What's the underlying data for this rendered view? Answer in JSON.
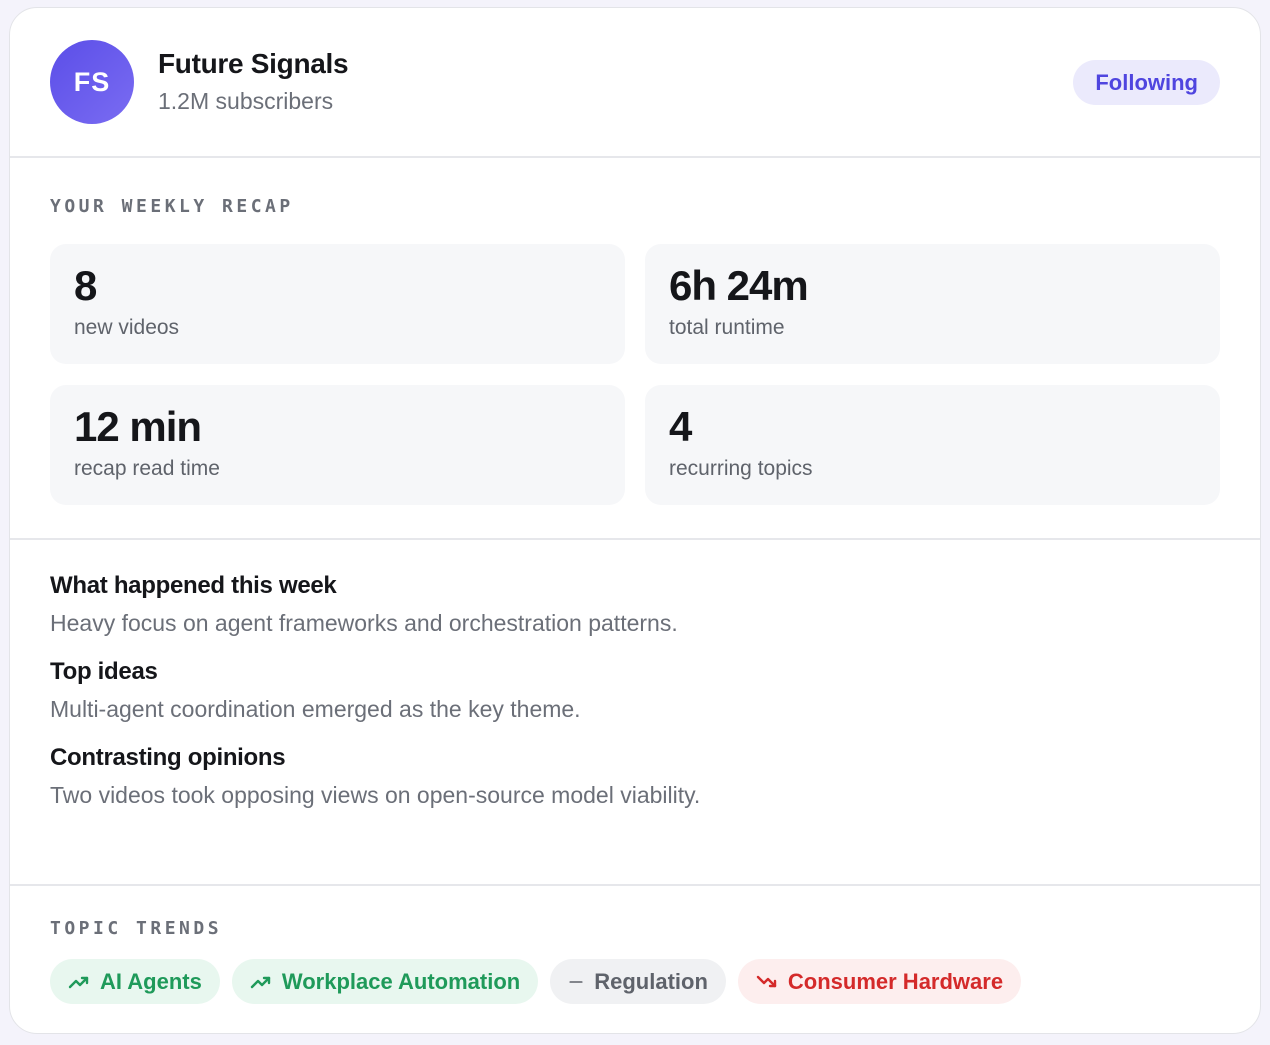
{
  "channel": {
    "initials": "FS",
    "name": "Future Signals",
    "subscribers": "1.2M subscribers",
    "follow_label": "Following",
    "avatar_color": "#5b4ee8"
  },
  "recap": {
    "section_label": "YOUR WEEKLY RECAP",
    "stats": [
      {
        "value": "8",
        "label": "new videos"
      },
      {
        "value": "6h 24m",
        "label": "total runtime"
      },
      {
        "value": "12 min",
        "label": "recap read time"
      },
      {
        "value": "4",
        "label": "recurring topics"
      }
    ]
  },
  "summary": {
    "blocks": [
      {
        "title": "What happened this week",
        "text": "Heavy focus on agent frameworks and orchestration patterns."
      },
      {
        "title": "Top ideas",
        "text": "Multi-agent coordination emerged as the key theme."
      },
      {
        "title": "Contrasting opinions",
        "text": "Two videos took opposing views on open-source model viability."
      }
    ]
  },
  "trends": {
    "section_label": "TOPIC TRENDS",
    "chips": [
      {
        "label": "AI Agents",
        "direction": "up",
        "icon": "trending-up-icon",
        "color": "#1f9a5a"
      },
      {
        "label": "Workplace Automation",
        "direction": "up",
        "icon": "trending-up-icon",
        "color": "#1f9a5a"
      },
      {
        "label": "Regulation",
        "direction": "flat",
        "icon": "dash-icon",
        "color": "#5f636b"
      },
      {
        "label": "Consumer Hardware",
        "direction": "down",
        "icon": "trending-down-icon",
        "color": "#d42a2a"
      }
    ]
  }
}
